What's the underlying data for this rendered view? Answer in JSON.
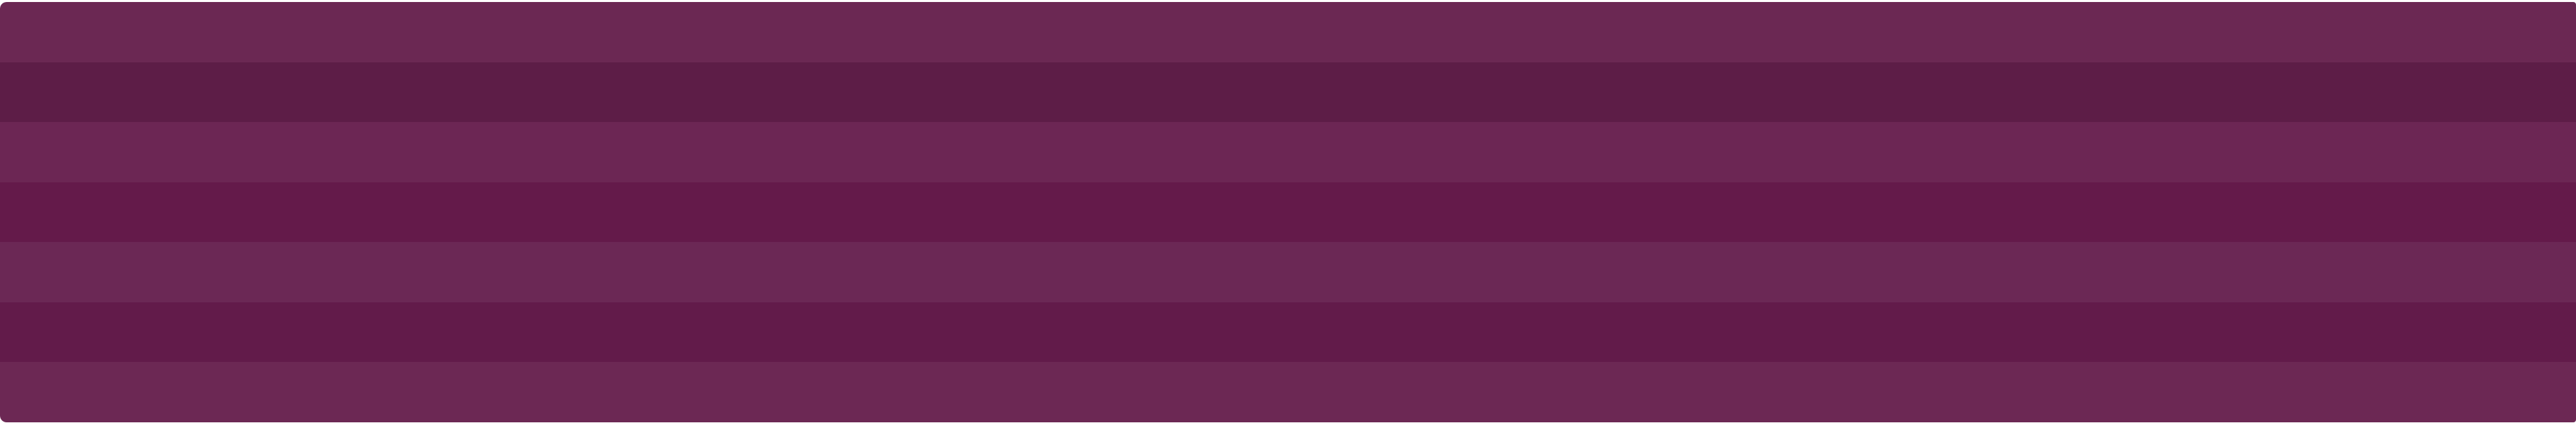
{
  "background": {
    "stripe_colors": [
      "#6b2853",
      "#5d1d47",
      "#6c2654",
      "#641a4a",
      "#6b2855",
      "#621b4a",
      "#6c2854"
    ]
  }
}
